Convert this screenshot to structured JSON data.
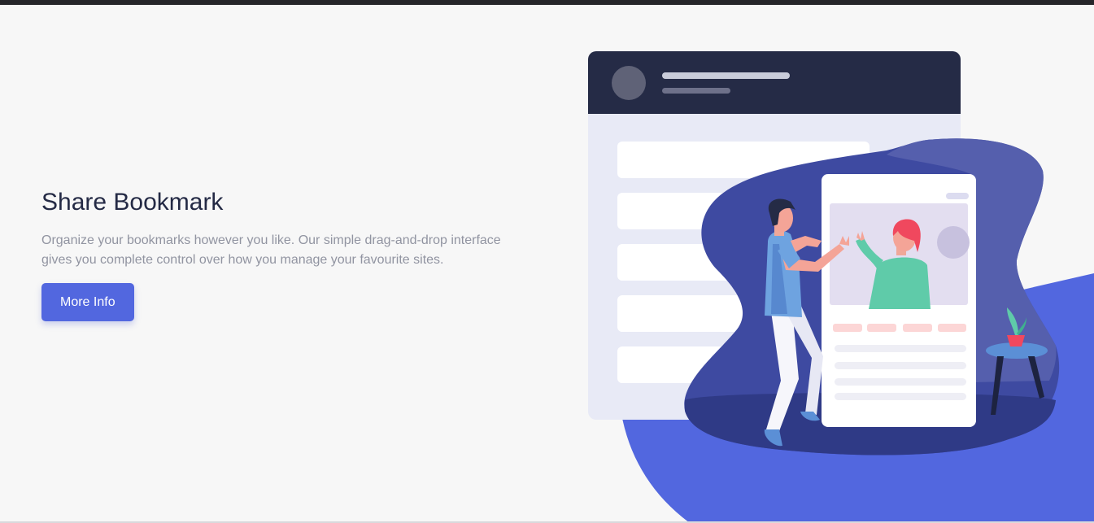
{
  "hero": {
    "title": "Share Bookmark",
    "description": "Organize your bookmarks however you like. Our simple drag-and-drop interface gives you complete control over how you manage your favourite sites.",
    "button_label": "More Info"
  },
  "colors": {
    "accent": "#5267df",
    "dark_navy": "#242a45",
    "text_muted": "#9194a1",
    "background": "#f7f7f7"
  },
  "illustration": {
    "icon": "bookmark-share-illustration"
  }
}
